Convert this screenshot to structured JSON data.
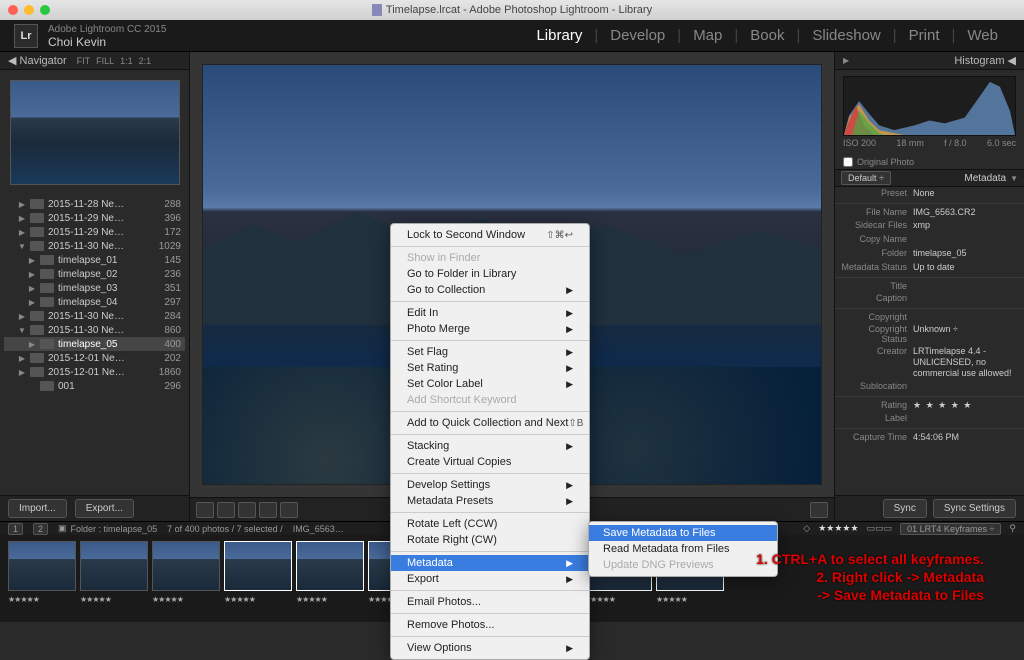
{
  "titlebar": {
    "title": "Timelapse.lrcat - Adobe Photoshop Lightroom - Library"
  },
  "header": {
    "brand_line": "Adobe Lightroom CC 2015",
    "user": "Choi Kevin",
    "modules": [
      "Library",
      "Develop",
      "Map",
      "Book",
      "Slideshow",
      "Print",
      "Web"
    ],
    "active": "Library"
  },
  "left": {
    "nav_title": "Navigator",
    "nav_levels": [
      "FIT",
      "FILL",
      "1:1",
      "2:1"
    ],
    "folders": [
      {
        "ind": 1,
        "tw": "d",
        "name": "2015-11-28 Ne…",
        "count": "288"
      },
      {
        "ind": 1,
        "tw": "d",
        "name": "2015-11-29 Ne…",
        "count": "396"
      },
      {
        "ind": 1,
        "tw": "d",
        "name": "2015-11-29 Ne…",
        "count": "172"
      },
      {
        "ind": 1,
        "tw": "o",
        "name": "2015-11-30 Ne…",
        "count": "1029"
      },
      {
        "ind": 2,
        "tw": "d",
        "name": "timelapse_01",
        "count": "145"
      },
      {
        "ind": 2,
        "tw": "d",
        "name": "timelapse_02",
        "count": "236"
      },
      {
        "ind": 2,
        "tw": "d",
        "name": "timelapse_03",
        "count": "351"
      },
      {
        "ind": 2,
        "tw": "d",
        "name": "timelapse_04",
        "count": "297"
      },
      {
        "ind": 1,
        "tw": "d",
        "name": "2015-11-30 Ne…",
        "count": "284"
      },
      {
        "ind": 1,
        "tw": "o",
        "name": "2015-11-30 Ne…",
        "count": "860"
      },
      {
        "ind": 2,
        "tw": "d",
        "name": "timelapse_05",
        "count": "400",
        "sel": true
      },
      {
        "ind": 1,
        "tw": "d",
        "name": "2015-12-01 Ne…",
        "count": "202"
      },
      {
        "ind": 1,
        "tw": "d",
        "name": "2015-12-01 Ne…",
        "count": "1860"
      },
      {
        "ind": 2,
        "tw": "",
        "name": "001",
        "count": "296"
      }
    ],
    "import_btn": "Import...",
    "export_btn": "Export..."
  },
  "right": {
    "histo_title": "Histogram",
    "histo_info": {
      "iso": "ISO 200",
      "fl": "18 mm",
      "ap": "f / 8.0",
      "ss": "6.0 sec"
    },
    "orig_label": "Original Photo",
    "meta_title": "Metadata",
    "default_label": "Default",
    "preset_k": "Preset",
    "preset_v": "None",
    "rows": [
      {
        "k": "File Name",
        "v": "IMG_6563.CR2"
      },
      {
        "k": "Sidecar Files",
        "v": "xmp"
      },
      {
        "k": "Copy Name",
        "v": ""
      },
      {
        "k": "Folder",
        "v": "timelapse_05"
      },
      {
        "k": "Metadata Status",
        "v": "Up to date"
      }
    ],
    "rows2": [
      {
        "k": "Title",
        "v": ""
      },
      {
        "k": "Caption",
        "v": ""
      }
    ],
    "rows3": [
      {
        "k": "Copyright",
        "v": ""
      },
      {
        "k": "Copyright Status",
        "v": "Unknown  ÷"
      },
      {
        "k": "Creator",
        "v": "LRTimelapse 4.4 - UNLICENSED, no commercial use allowed!"
      },
      {
        "k": "Sublocation",
        "v": ""
      }
    ],
    "rating_k": "Rating",
    "rating_v": "★ ★ ★ ★ ★",
    "label_k": "Label",
    "label_v": "",
    "capture_k": "Capture Time",
    "capture_v": "4:54:06 PM",
    "sync": "Sync",
    "sync_settings": "Sync Settings"
  },
  "infobar": {
    "pages": [
      "1",
      "2"
    ],
    "folder_lbl": "Folder : timelapse_05",
    "count": "7 of 400 photos / 7 selected /",
    "file": "IMG_6563…",
    "stars": "★★★★★",
    "filter": "01 LRT4 Keyframes"
  },
  "context_menu": {
    "items": [
      {
        "t": "Lock to Second Window",
        "sc": "⇧⌘↩"
      },
      {
        "sep": true
      },
      {
        "t": "Show in Finder",
        "dis": true
      },
      {
        "t": "Go to Folder in Library"
      },
      {
        "t": "Go to Collection",
        "arr": true
      },
      {
        "sep": true
      },
      {
        "t": "Edit In",
        "arr": true
      },
      {
        "t": "Photo Merge",
        "arr": true
      },
      {
        "sep": true
      },
      {
        "t": "Set Flag",
        "arr": true
      },
      {
        "t": "Set Rating",
        "arr": true
      },
      {
        "t": "Set Color Label",
        "arr": true
      },
      {
        "t": "Add Shortcut Keyword",
        "dis": true
      },
      {
        "sep": true
      },
      {
        "t": "Add to Quick Collection and Next",
        "sc": "⇧B"
      },
      {
        "sep": true
      },
      {
        "t": "Stacking",
        "arr": true
      },
      {
        "t": "Create Virtual Copies"
      },
      {
        "sep": true
      },
      {
        "t": "Develop Settings",
        "arr": true
      },
      {
        "t": "Metadata Presets",
        "arr": true
      },
      {
        "sep": true
      },
      {
        "t": "Rotate Left (CCW)"
      },
      {
        "t": "Rotate Right (CW)"
      },
      {
        "sep": true
      },
      {
        "t": "Metadata",
        "arr": true,
        "hl": true
      },
      {
        "t": "Export",
        "arr": true
      },
      {
        "sep": true
      },
      {
        "t": "Email Photos..."
      },
      {
        "sep": true
      },
      {
        "t": "Remove Photos..."
      },
      {
        "sep": true
      },
      {
        "t": "View Options",
        "arr": true
      }
    ]
  },
  "submenu": {
    "items": [
      {
        "t": "Save Metadata to Files",
        "hl": true
      },
      {
        "t": "Read Metadata from Files"
      },
      {
        "t": "Update DNG Previews",
        "dis": true
      }
    ]
  },
  "annotation": {
    "l1": "1. CTRL+A to select all keyframes.",
    "l2": "2. Right click -> Metadata",
    "l3": "-> Save Metadata to Files"
  }
}
